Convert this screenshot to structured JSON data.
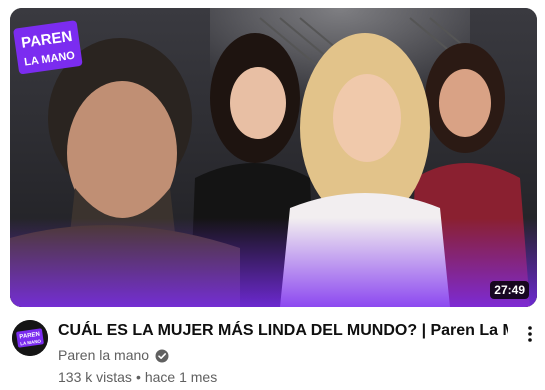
{
  "video": {
    "title": "CUÁL ES LA MUJER MÁS LINDA DEL MUNDO? | Paren La Mano",
    "duration": "27:49",
    "views": "133 k vistas",
    "separator": "•",
    "age": "hace 1 mes"
  },
  "channel": {
    "name": "Paren la mano",
    "verified": true,
    "logo_text_line1": "PAREN",
    "logo_text_line2": "LA MANO"
  },
  "colors": {
    "brand_purple": "#7b2cf0",
    "duration_bg": "#000000",
    "title_text": "#0f0f0f",
    "secondary_text": "#606060"
  },
  "icons": {
    "verified": "verified-check-icon",
    "more": "more-vertical-icon"
  }
}
